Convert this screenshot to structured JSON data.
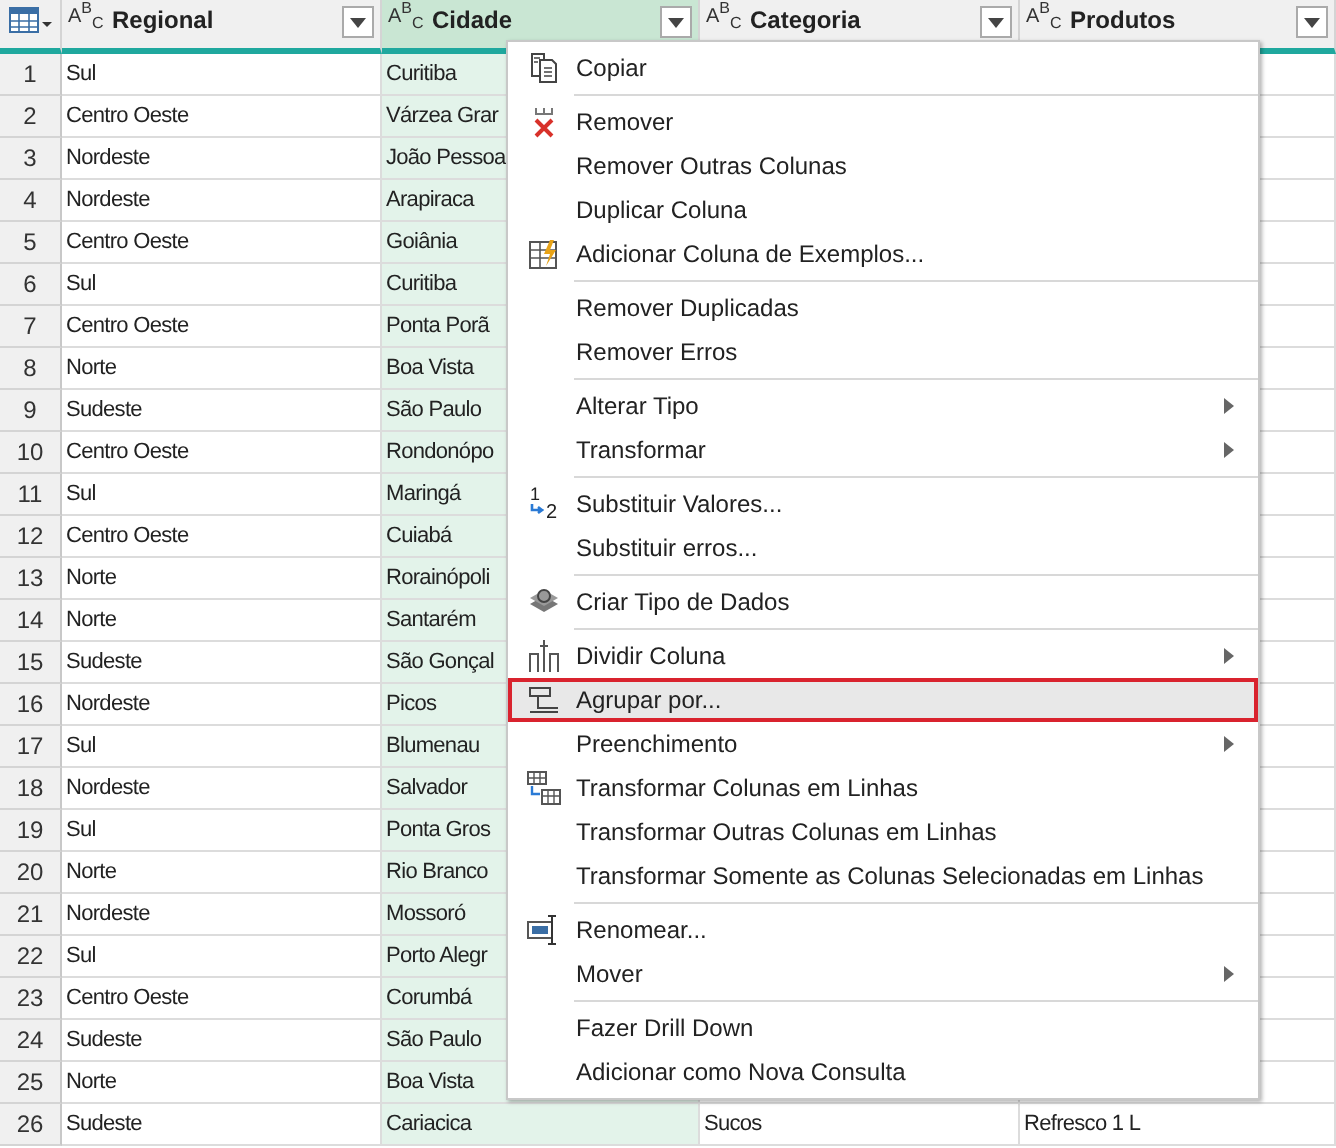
{
  "table": {
    "columns": [
      {
        "type": "A$^{B}$$_{C}$",
        "label": "Regional",
        "selected": false
      },
      {
        "type": "A$^{B}$$_{C}$",
        "label": "Cidade",
        "selected": true
      },
      {
        "type": "A$^{B}$$_{C}$",
        "label": "Categoria",
        "selected": false
      },
      {
        "type": "A$^{B}$$_{C}$",
        "label": "Produtos",
        "selected": false
      }
    ],
    "rows": [
      {
        "n": "1",
        "cells": [
          "Sul",
          "Curitiba"
        ]
      },
      {
        "n": "2",
        "cells": [
          "Centro Oeste",
          "Várzea Grar"
        ]
      },
      {
        "n": "3",
        "cells": [
          "Nordeste",
          "João Pessoa"
        ]
      },
      {
        "n": "4",
        "cells": [
          "Nordeste",
          "Arapiraca"
        ]
      },
      {
        "n": "5",
        "cells": [
          "Centro Oeste",
          "Goiânia"
        ]
      },
      {
        "n": "6",
        "cells": [
          "Sul",
          "Curitiba"
        ]
      },
      {
        "n": "7",
        "cells": [
          "Centro Oeste",
          "Ponta Porã"
        ]
      },
      {
        "n": "8",
        "cells": [
          "Norte",
          "Boa Vista"
        ]
      },
      {
        "n": "9",
        "cells": [
          "Sudeste",
          "São Paulo"
        ]
      },
      {
        "n": "10",
        "cells": [
          "Centro Oeste",
          "Rondonópo"
        ]
      },
      {
        "n": "11",
        "cells": [
          "Sul",
          "Maringá"
        ]
      },
      {
        "n": "12",
        "cells": [
          "Centro Oeste",
          "Cuiabá"
        ]
      },
      {
        "n": "13",
        "cells": [
          "Norte",
          "Rorainópoli"
        ]
      },
      {
        "n": "14",
        "cells": [
          "Norte",
          "Santarém"
        ]
      },
      {
        "n": "15",
        "cells": [
          "Sudeste",
          "São Gonçal"
        ]
      },
      {
        "n": "16",
        "cells": [
          "Nordeste",
          "Picos"
        ]
      },
      {
        "n": "17",
        "cells": [
          "Sul",
          "Blumenau"
        ]
      },
      {
        "n": "18",
        "cells": [
          "Nordeste",
          "Salvador"
        ]
      },
      {
        "n": "19",
        "cells": [
          "Sul",
          "Ponta Gros"
        ]
      },
      {
        "n": "20",
        "cells": [
          "Norte",
          "Rio Branco"
        ]
      },
      {
        "n": "21",
        "cells": [
          "Nordeste",
          "Mossoró"
        ]
      },
      {
        "n": "22",
        "cells": [
          "Sul",
          "Porto Alegr"
        ]
      },
      {
        "n": "23",
        "cells": [
          "Centro Oeste",
          "Corumbá"
        ]
      },
      {
        "n": "24",
        "cells": [
          "Sudeste",
          "São Paulo"
        ]
      },
      {
        "n": "25",
        "cells": [
          "Norte",
          "Boa Vista"
        ]
      },
      {
        "n": "26",
        "cells": [
          "Sudeste",
          "Cariacica",
          "Sucos",
          "Refresco 1 L"
        ]
      }
    ]
  },
  "context_menu": {
    "groups": [
      [
        {
          "label": "Copiar",
          "submenu": false,
          "selected": false
        }
      ],
      [
        {
          "label": "Remover",
          "submenu": false,
          "selected": false
        },
        {
          "label": "Remover Outras Colunas",
          "submenu": false,
          "selected": false
        },
        {
          "label": "Duplicar Coluna",
          "submenu": false,
          "selected": false
        },
        {
          "label": "Adicionar Coluna de Exemplos...",
          "submenu": false,
          "selected": false
        }
      ],
      [
        {
          "label": "Remover Duplicadas",
          "submenu": false,
          "selected": false
        },
        {
          "label": "Remover Erros",
          "submenu": false,
          "selected": false
        }
      ],
      [
        {
          "label": "Alterar Tipo",
          "submenu": true,
          "selected": false
        },
        {
          "label": "Transformar",
          "submenu": true,
          "selected": false
        }
      ],
      [
        {
          "label": "Substituir Valores...",
          "submenu": false,
          "selected": false,
          "icon_marks": [
            "1",
            "2"
          ]
        },
        {
          "label": "Substituir erros...",
          "submenu": false,
          "selected": false
        }
      ],
      [
        {
          "label": "Criar Tipo de Dados",
          "submenu": false,
          "selected": false
        }
      ],
      [
        {
          "label": "Dividir Coluna",
          "submenu": true,
          "selected": false
        },
        {
          "label": "Agrupar por...",
          "submenu": false,
          "selected": true
        },
        {
          "label": "Preenchimento",
          "submenu": true,
          "selected": false
        },
        {
          "label": "Transformar Colunas em Linhas",
          "submenu": false,
          "selected": false
        },
        {
          "label": "Transformar Outras Colunas em Linhas",
          "submenu": false,
          "selected": false
        },
        {
          "label": "Transformar Somente as Colunas Selecionadas em Linhas",
          "submenu": false,
          "selected": false
        }
      ],
      [
        {
          "label": "Renomear...",
          "submenu": false,
          "selected": false
        },
        {
          "label": "Mover",
          "submenu": true,
          "selected": false
        }
      ],
      [
        {
          "label": "Fazer Drill Down",
          "submenu": false,
          "selected": false
        },
        {
          "label": "Adicionar como Nova Consulta",
          "submenu": false,
          "selected": false
        }
      ]
    ]
  }
}
